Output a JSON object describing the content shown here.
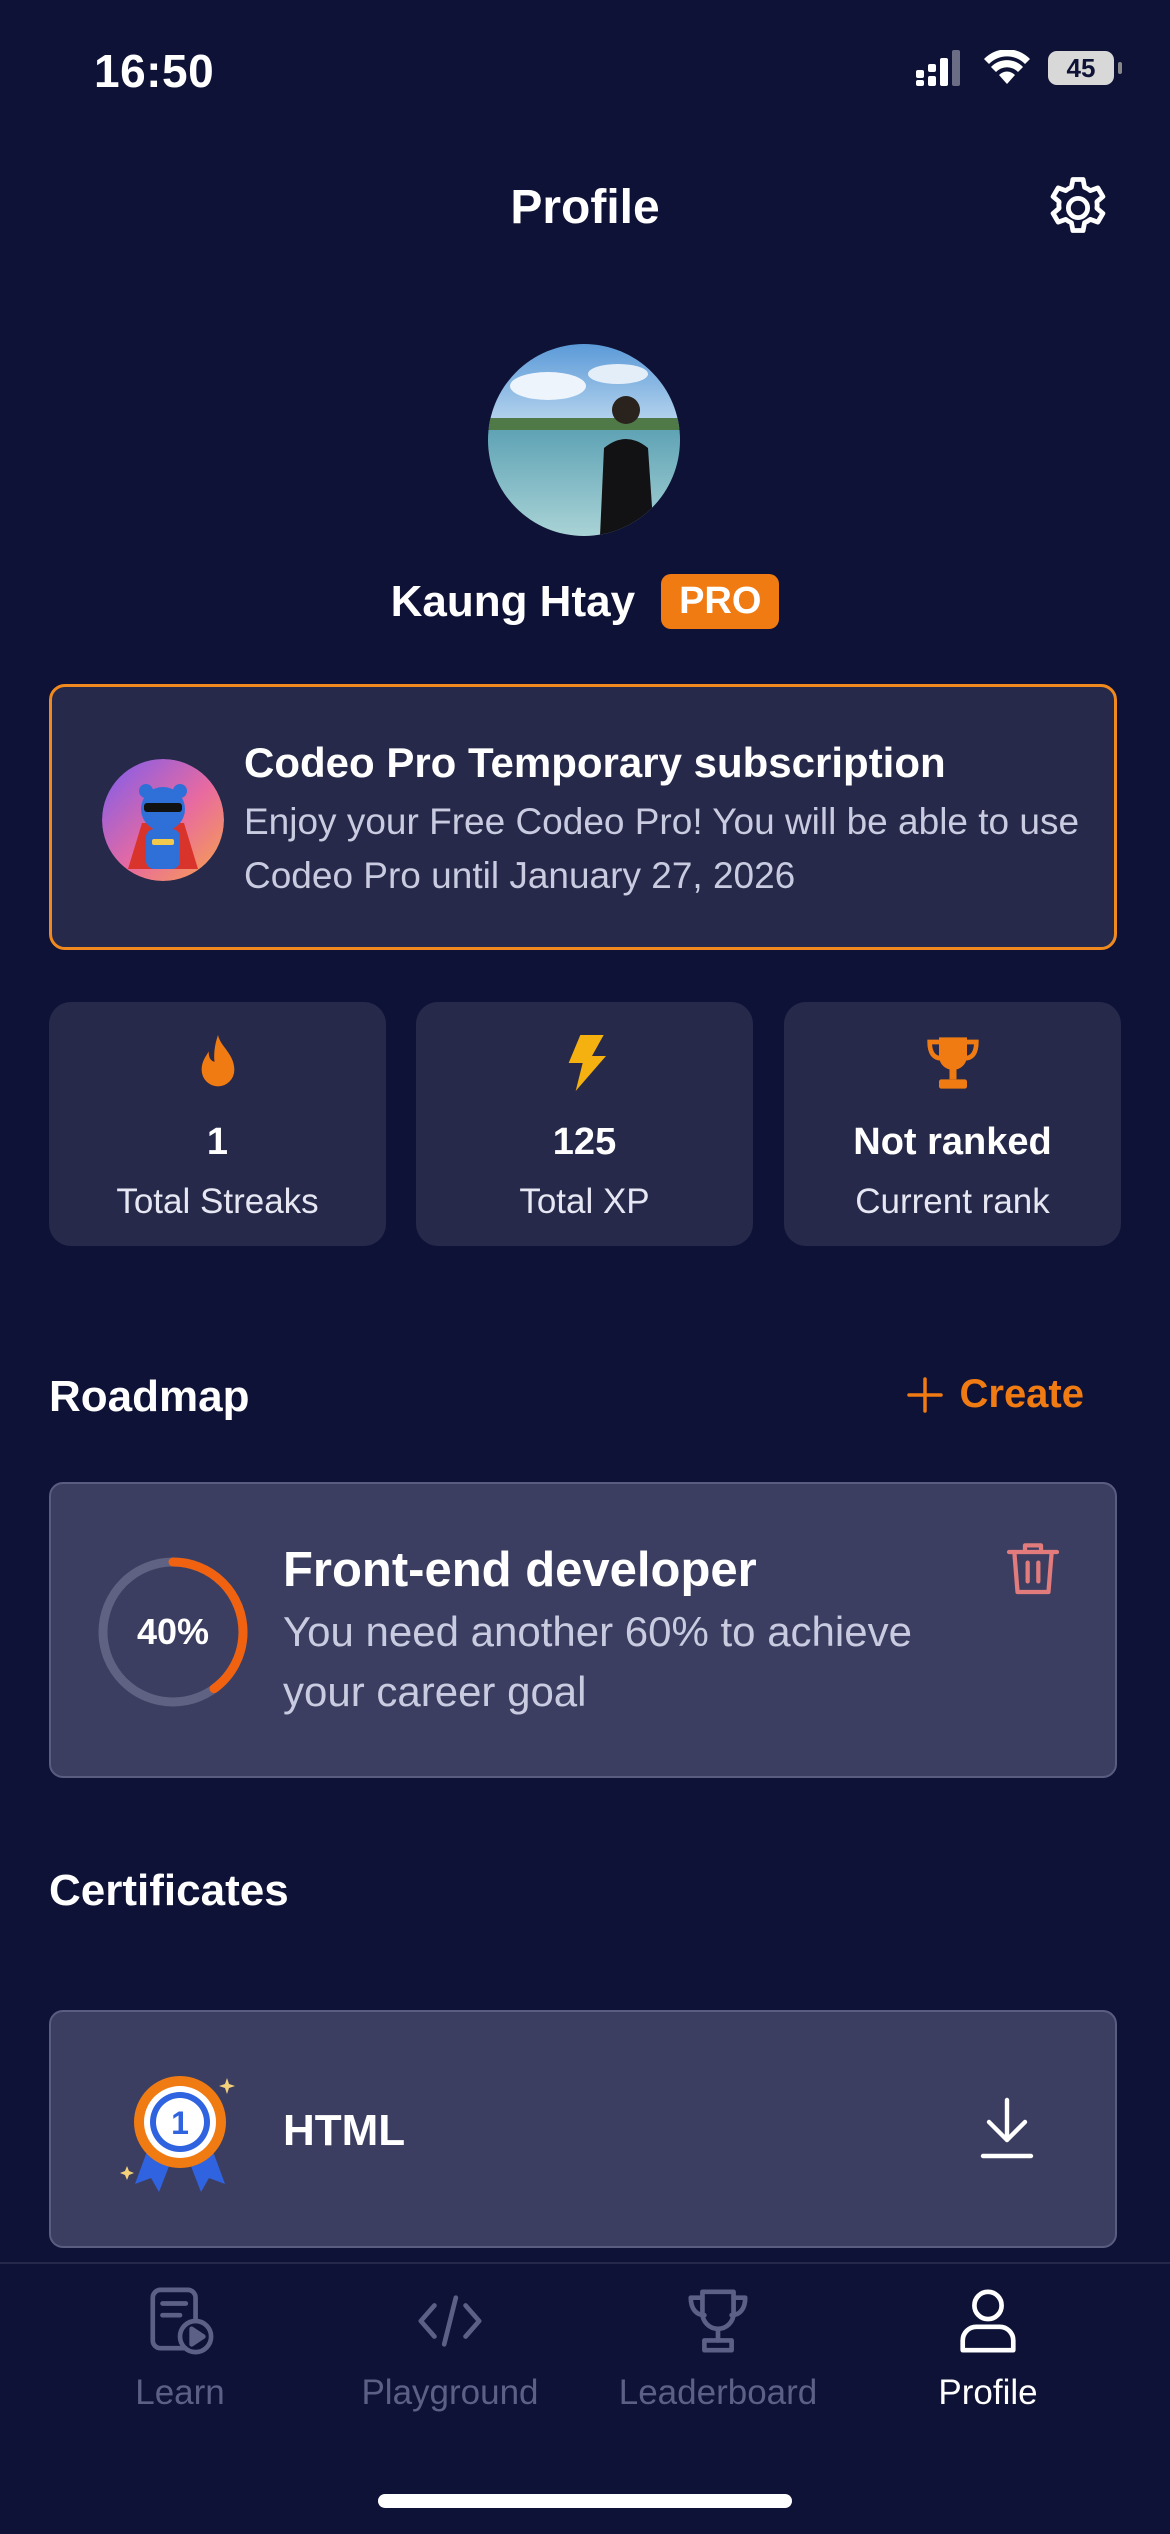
{
  "status_bar": {
    "time": "16:50",
    "battery": "45"
  },
  "header": {
    "title": "Profile"
  },
  "user": {
    "name": "Kaung Htay",
    "badge": "PRO"
  },
  "subscription": {
    "title": "Codeo Pro Temporary subscription",
    "description": "Enjoy your Free Codeo Pro! You will be able to use Codeo Pro until January 27, 2026"
  },
  "stats": [
    {
      "icon": "flame-icon",
      "value": "1",
      "label": "Total Streaks"
    },
    {
      "icon": "lightning-icon",
      "value": "125",
      "label": "Total XP"
    },
    {
      "icon": "trophy-icon",
      "value": "Not ranked",
      "label": "Current rank"
    }
  ],
  "roadmap": {
    "section_title": "Roadmap",
    "create_label": "Create",
    "item": {
      "progress_label": "40%",
      "progress": 0.4,
      "title": "Front-end developer",
      "description": "You need another 60% to achieve your career goal"
    }
  },
  "certificates": {
    "section_title": "Certificates",
    "items": [
      {
        "name": "HTML"
      }
    ]
  },
  "tabbar": {
    "tabs": [
      {
        "label": "Learn",
        "icon": "learn-icon",
        "active": false
      },
      {
        "label": "Playground",
        "icon": "code-icon",
        "active": false
      },
      {
        "label": "Leaderboard",
        "icon": "trophy-outline-icon",
        "active": false
      },
      {
        "label": "Profile",
        "icon": "person-icon",
        "active": true
      }
    ]
  },
  "colors": {
    "background": "#0e1236",
    "accent": "#f07b12",
    "card": "#26294a",
    "danger": "#e27b7b"
  }
}
